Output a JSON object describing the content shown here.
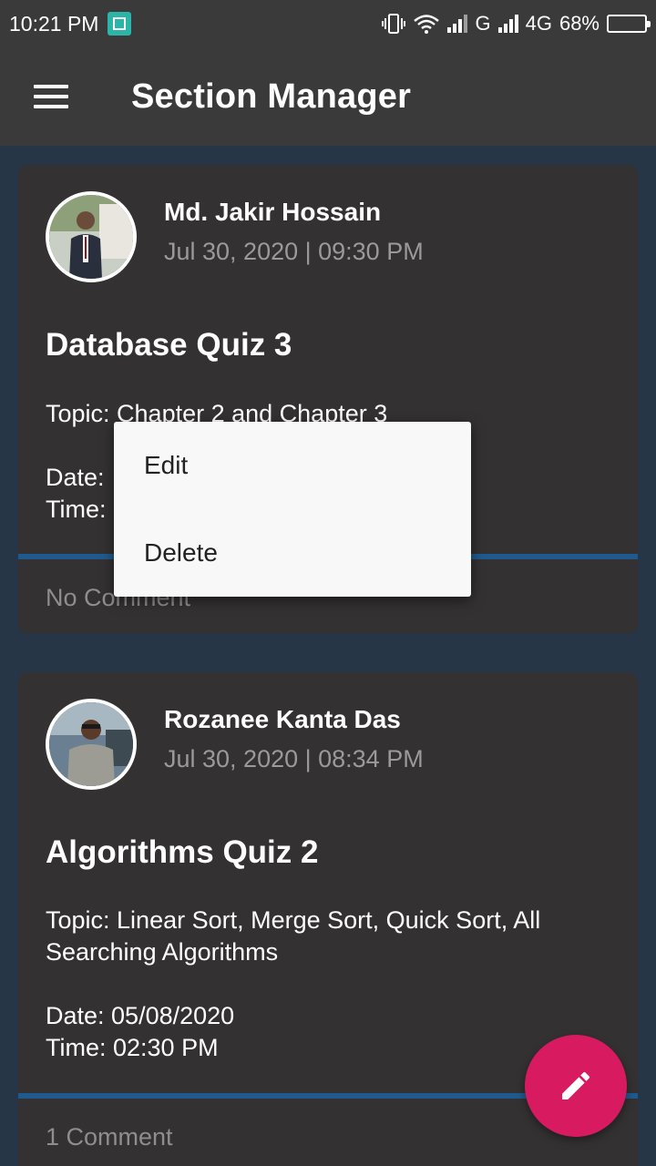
{
  "status_bar": {
    "time": "10:21 PM",
    "network_1": "G",
    "network_2": "4G",
    "battery": "68%",
    "battery_level": 0.68
  },
  "app_bar": {
    "title": "Section Manager",
    "menu_icon": "hamburger-menu-icon"
  },
  "posts": [
    {
      "author": "Md. Jakir Hossain",
      "timestamp": "Jul 30, 2020 | 09:30 PM",
      "title": "Database Quiz 3",
      "topic": "Topic: Chapter 2 and Chapter 3",
      "date": "Date: ",
      "time": "Time: ",
      "comments": "No Comment"
    },
    {
      "author": "Rozanee Kanta Das",
      "timestamp": "Jul 30, 2020 | 08:34 PM",
      "title": "Algorithms Quiz 2",
      "topic": "Topic: Linear Sort, Merge Sort, Quick Sort, All Searching Algorithms",
      "date": "Date: 05/08/2020",
      "time": "Time: 02:30 PM",
      "comments": "1 Comment"
    }
  ],
  "context_menu": {
    "items": [
      "Edit",
      "Delete"
    ]
  },
  "fab": {
    "icon": "pencil-edit-icon",
    "color": "#d81b60"
  },
  "colors": {
    "background": "#263646",
    "card": "#333132",
    "divider": "#1f5a8e",
    "toolbar": "#3a3a3a"
  }
}
